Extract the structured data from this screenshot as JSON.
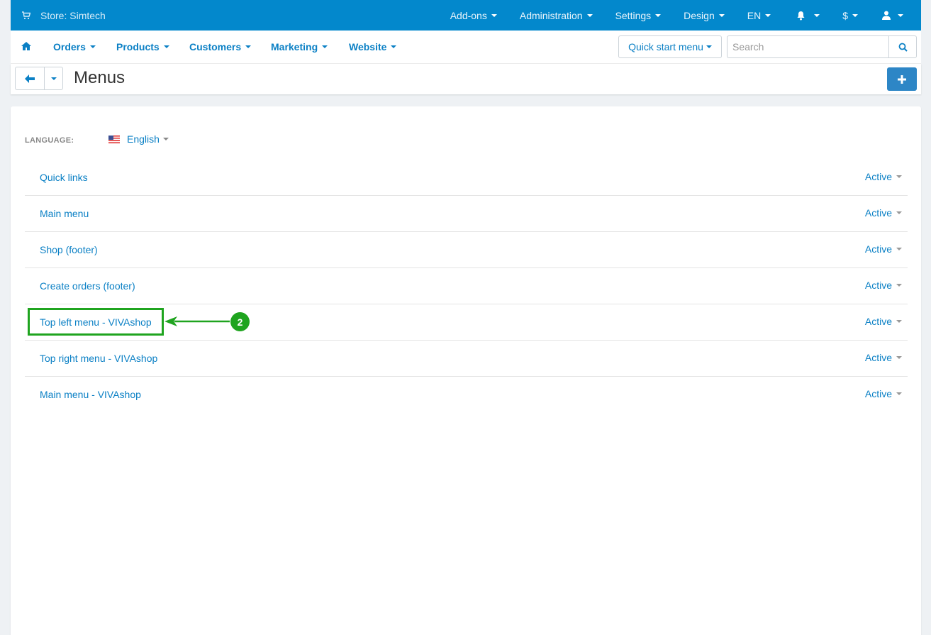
{
  "topbar": {
    "store": "Store: Simtech",
    "items": [
      {
        "label": "Add-ons"
      },
      {
        "label": "Administration"
      },
      {
        "label": "Settings"
      },
      {
        "label": "Design"
      },
      {
        "label": "EN"
      },
      {
        "label": ""
      },
      {
        "label": "$"
      },
      {
        "label": ""
      }
    ]
  },
  "mainnav": {
    "items": [
      "Orders",
      "Products",
      "Customers",
      "Marketing",
      "Website"
    ],
    "quick_start": "Quick start menu",
    "search_placeholder": "Search"
  },
  "titlebar": {
    "title": "Menus"
  },
  "content": {
    "language_label": "LANGUAGE:",
    "language_value": "English",
    "menus": [
      {
        "name": "Quick links",
        "status": "Active"
      },
      {
        "name": "Main menu",
        "status": "Active"
      },
      {
        "name": "Shop (footer)",
        "status": "Active"
      },
      {
        "name": "Create orders (footer)",
        "status": "Active"
      },
      {
        "name": "Top left menu - VIVAshop",
        "status": "Active"
      },
      {
        "name": "Top right menu - VIVAshop",
        "status": "Active"
      },
      {
        "name": "Main menu - VIVAshop",
        "status": "Active"
      }
    ]
  },
  "annotation": {
    "badge": "2",
    "color": "#1fa41f"
  },
  "colors": {
    "topbar": "#0388cc",
    "link": "#0b80c5",
    "primary_button": "#2d86c6"
  }
}
